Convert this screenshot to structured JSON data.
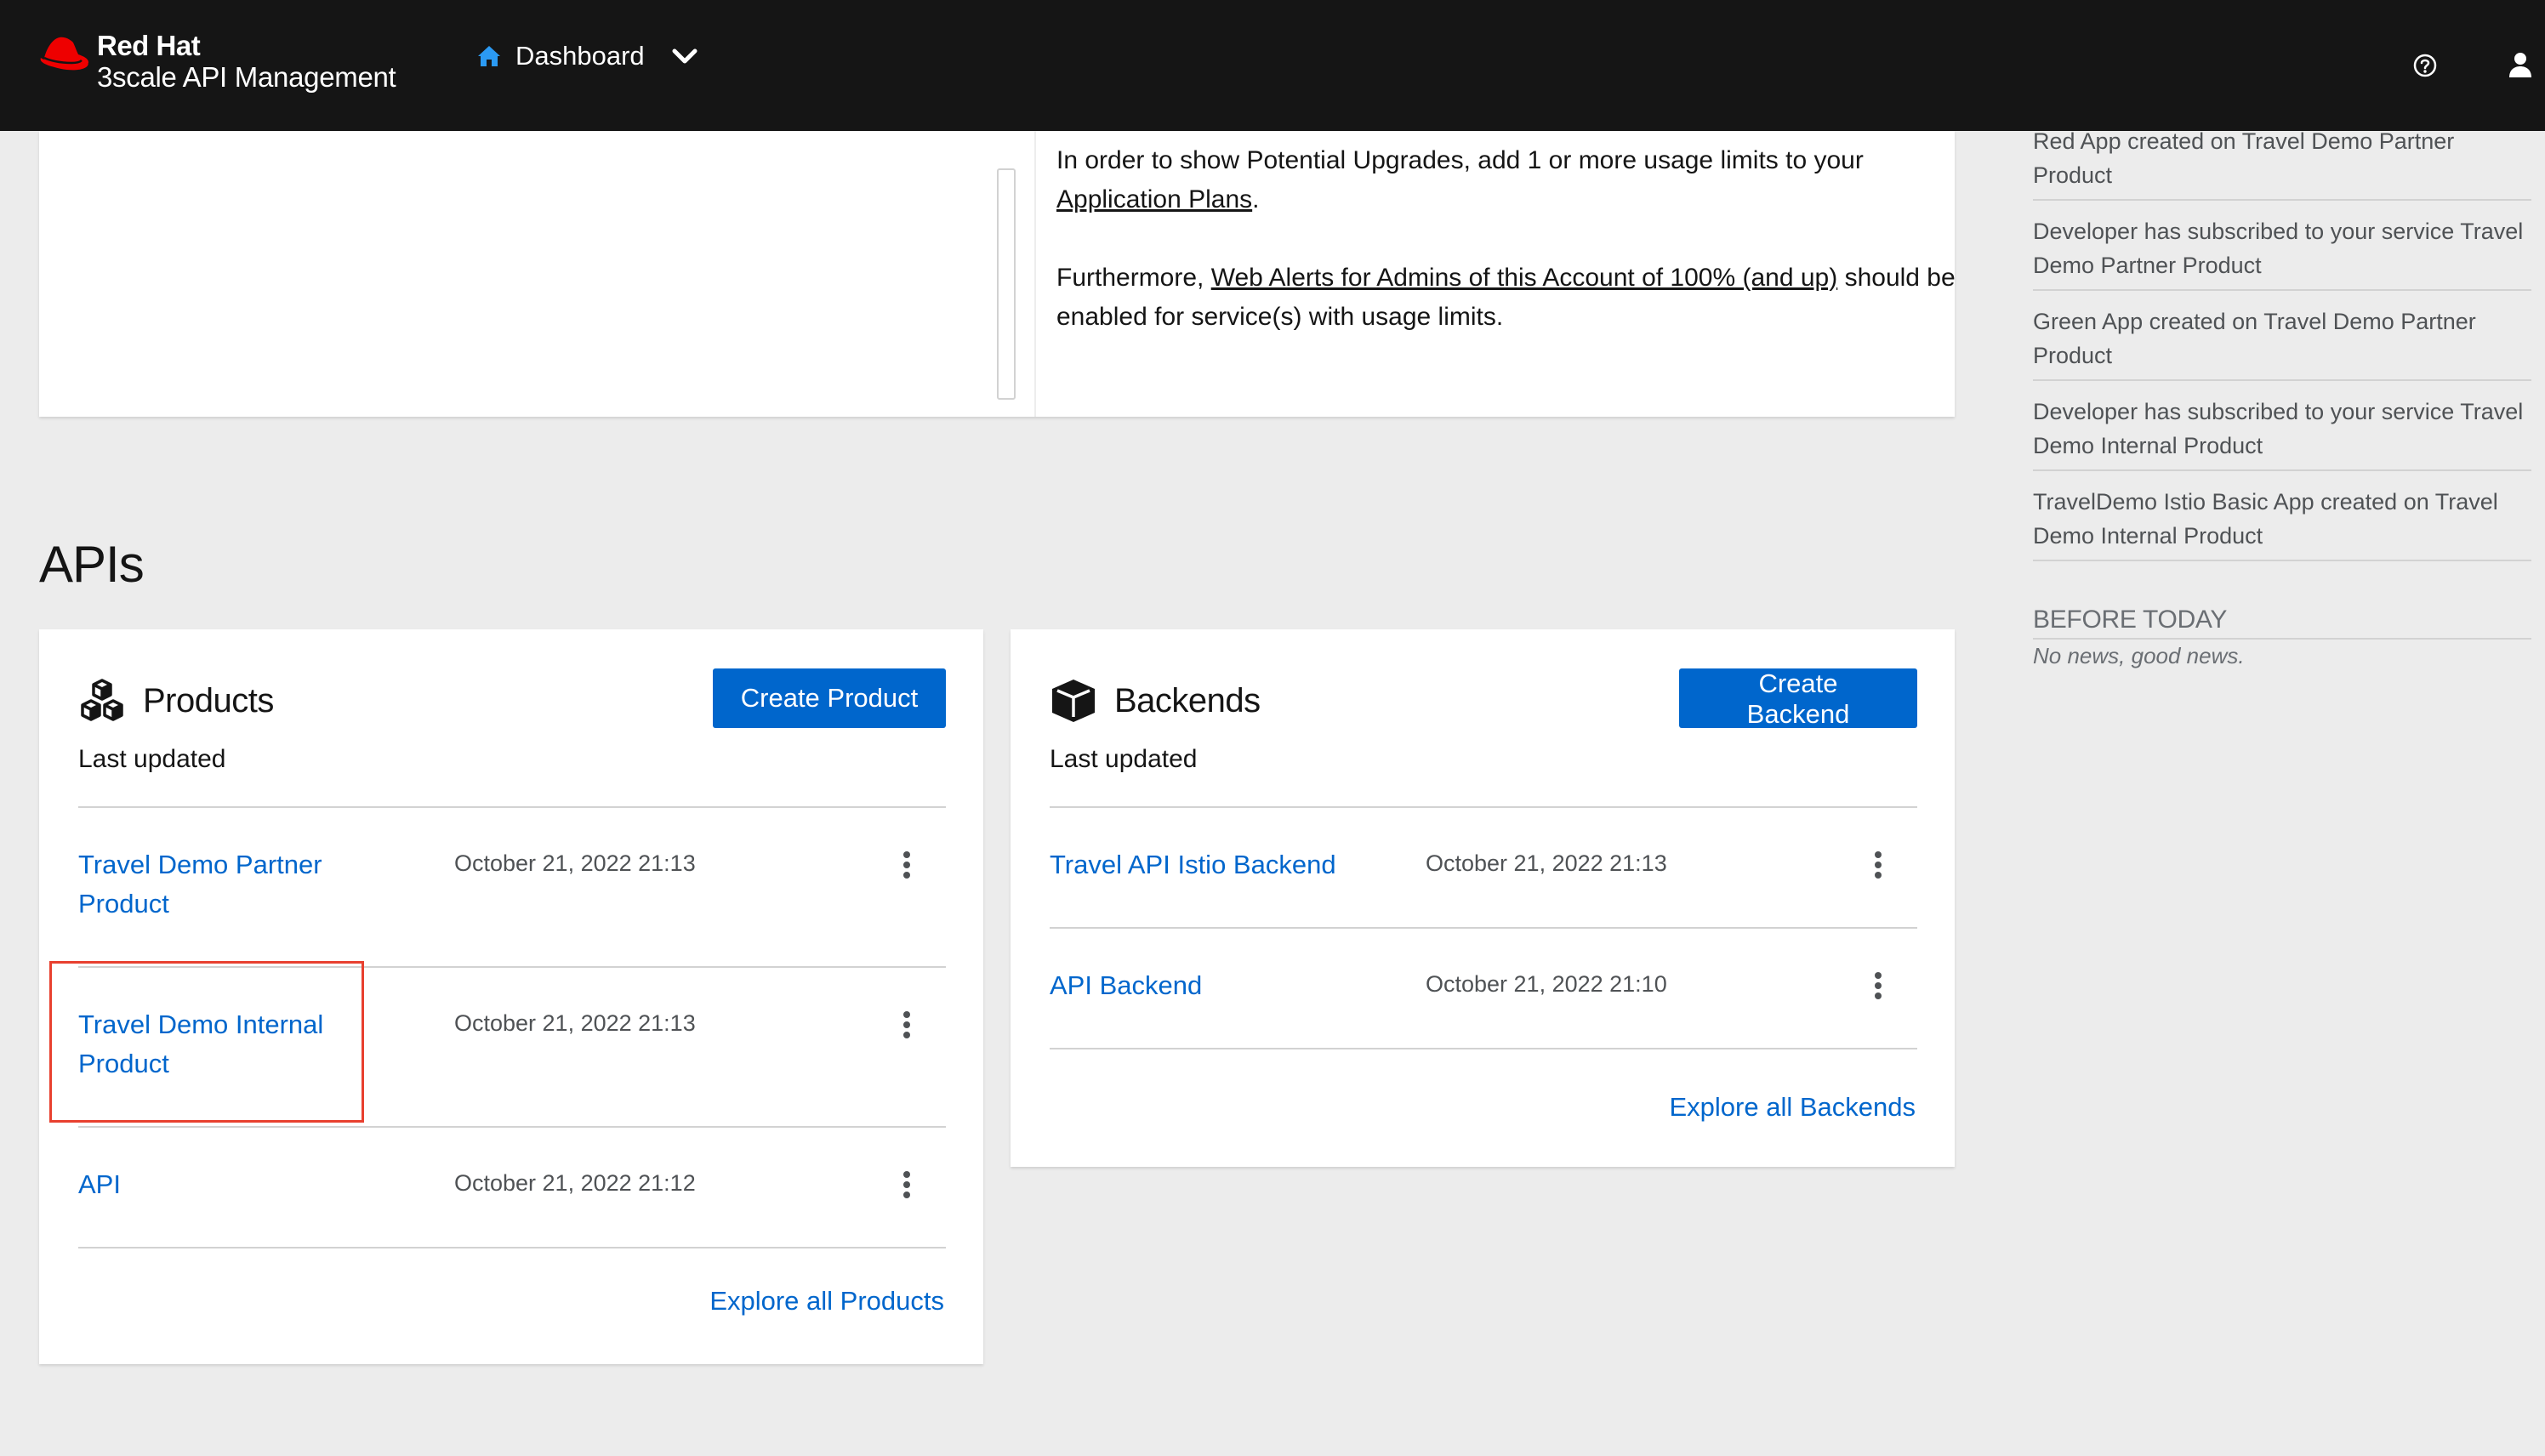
{
  "header": {
    "brand_line1": "Red Hat",
    "brand_line2": "3scale API Management",
    "context_label": "Dashboard",
    "icons": [
      "redhat-logo",
      "home-icon",
      "chevron-down-icon",
      "help-icon",
      "user-icon"
    ]
  },
  "upgrades": {
    "p1_text_before": "In order to show Potential Upgrades, add 1 or more usage limits to your ",
    "p1_link": "Application Plans",
    "p1_text_after": ".",
    "p2_text_before": "Furthermore, ",
    "p2_link": "Web Alerts for Admins of this Account of 100% (and up)",
    "p2_text_after": " should be enabled for service(s) with usage limits."
  },
  "apis": {
    "title": "APIs",
    "products": {
      "title": "Products",
      "subtitle": "Last updated",
      "create_label": "Create Product",
      "explore_label": "Explore all Products",
      "rows": [
        {
          "name": "Travel Demo Partner Product",
          "date": "October 21, 2022 21:13"
        },
        {
          "name": "Travel Demo Internal Product",
          "date": "October 21, 2022 21:13"
        },
        {
          "name": "API",
          "date": "October 21, 2022 21:12"
        }
      ]
    },
    "backends": {
      "title": "Backends",
      "subtitle": "Last updated",
      "create_label": "Create Backend",
      "explore_label": "Explore all Backends",
      "rows": [
        {
          "name": "Travel API Istio Backend",
          "date": "October 21, 2022 21:13"
        },
        {
          "name": "API Backend",
          "date": "October 21, 2022 21:10"
        }
      ]
    }
  },
  "sidebar": {
    "today_items": [
      "Red App created on Travel Demo Partner Product",
      "Developer has subscribed to your service Travel Demo Partner Product",
      "Green App created on Travel Demo Partner Product",
      "Developer has subscribed to your service Travel Demo Internal Product",
      "TravelDemo Istio Basic App created on Travel Demo Internal Product"
    ],
    "before_today_heading": "BEFORE TODAY",
    "before_today_empty": "No news, good news."
  },
  "colors": {
    "masthead": "#151515",
    "link": "#0066cc",
    "primary_button": "#0066cc",
    "highlight": "#e8402f",
    "page_bg": "#ececec"
  }
}
